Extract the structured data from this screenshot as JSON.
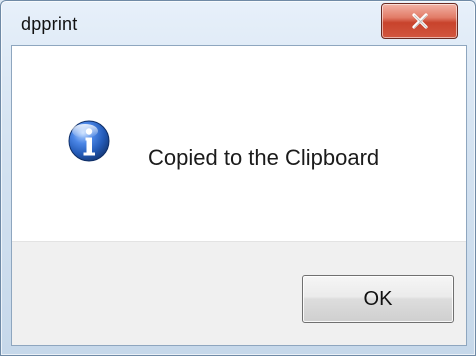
{
  "window": {
    "title": "dpprint"
  },
  "dialog": {
    "message": "Copied to the Clipboard",
    "icon": "info-icon"
  },
  "buttons": {
    "ok_label": "OK",
    "close_icon": "close-icon"
  },
  "colors": {
    "close_red": "#c8432c",
    "info_blue": "#2b62c6"
  }
}
